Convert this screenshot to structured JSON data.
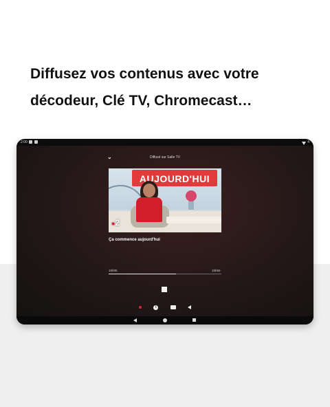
{
  "headline": "Diffusez vos contenus  avec votre\ndécodeur, Clé TV, Chromecast…",
  "device": {
    "status_time": "2:00",
    "battery": "4"
  },
  "player": {
    "cast_title": "Diffusé sur Salle TV",
    "thumbnail_banner": "AUJOURD'HUI",
    "channel_logo": "2",
    "program_title": "Ça commence aujourd'hui",
    "time_start": "15h05",
    "time_end": "15h55",
    "progress": 0.6
  },
  "icons": {
    "back": "chevron-down-icon",
    "stop": "stop-icon",
    "live": "live-dot-icon",
    "info": "info-icon",
    "subtitles": "subtitles-icon",
    "volume": "volume-icon"
  },
  "colors": {
    "accent_red": "#e0232e",
    "background_band": "#efefef"
  }
}
